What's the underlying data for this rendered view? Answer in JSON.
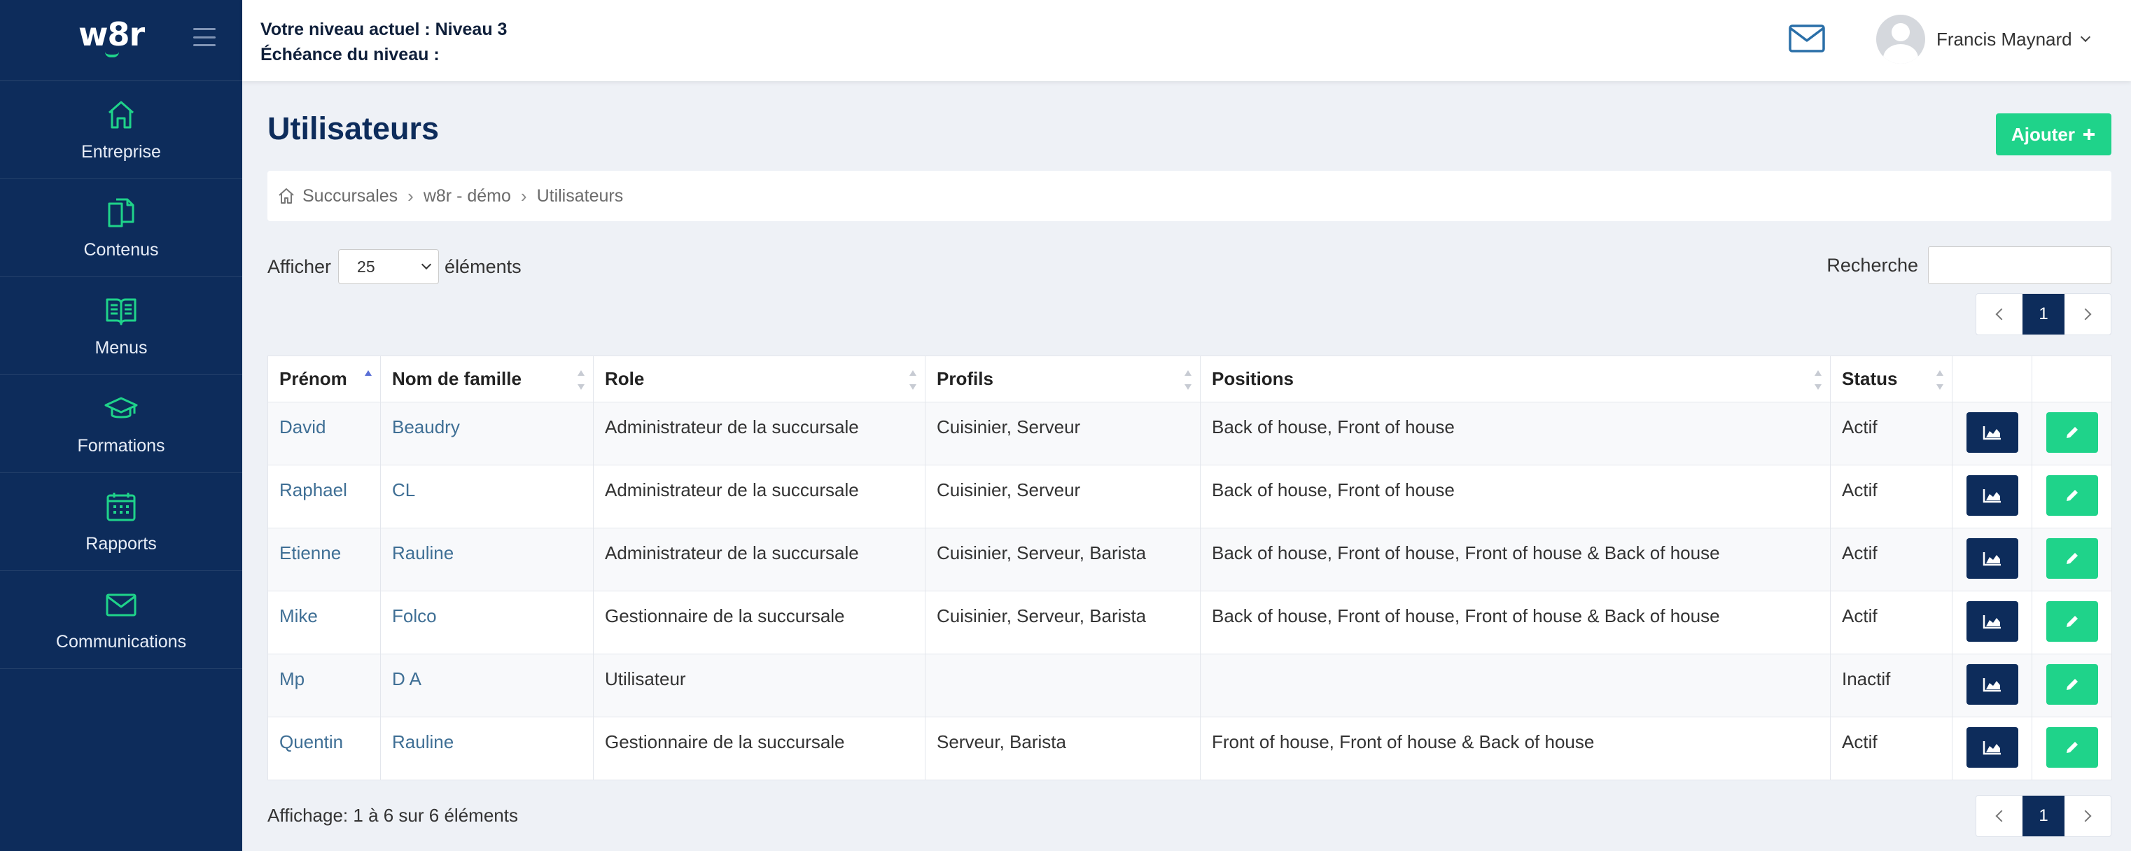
{
  "app": {
    "logo": "w8r"
  },
  "sidebar": {
    "items": [
      {
        "label": "Entreprise",
        "icon": "home-icon"
      },
      {
        "label": "Contenus",
        "icon": "documents-icon"
      },
      {
        "label": "Menus",
        "icon": "book-icon"
      },
      {
        "label": "Formations",
        "icon": "graduation-cap-icon"
      },
      {
        "label": "Rapports",
        "icon": "calendar-icon"
      },
      {
        "label": "Communications",
        "icon": "envelope-icon"
      }
    ]
  },
  "header": {
    "level_line": "Votre niveau actuel : Niveau 3",
    "deadline_line": "Échéance du niveau :",
    "user_name": "Francis Maynard"
  },
  "page": {
    "title": "Utilisateurs",
    "add_label": "Ajouter",
    "breadcrumb": [
      "Succursales",
      "w8r - démo",
      "Utilisateurs"
    ],
    "show_label": "Afficher",
    "page_size": "25",
    "elements_label": "éléments",
    "search_label": "Recherche",
    "current_page": "1",
    "footer_info": "Affichage: 1 à 6 sur 6 éléments"
  },
  "table": {
    "headers": [
      "Prénom",
      "Nom de famille",
      "Role",
      "Profils",
      "Positions",
      "Status"
    ],
    "rows": [
      {
        "first": "David",
        "last": "Beaudry",
        "role": "Administrateur de la succursale",
        "profils": "Cuisinier, Serveur",
        "positions": "Back of house, Front of house",
        "status": "Actif"
      },
      {
        "first": "Raphael",
        "last": "CL",
        "role": "Administrateur de la succursale",
        "profils": "Cuisinier, Serveur",
        "positions": "Back of house, Front of house",
        "status": "Actif"
      },
      {
        "first": "Etienne",
        "last": "Rauline",
        "role": "Administrateur de la succursale",
        "profils": "Cuisinier, Serveur, Barista",
        "positions": "Back of house, Front of house, Front of house & Back of house",
        "status": "Actif"
      },
      {
        "first": "Mike",
        "last": "Folco",
        "role": "Gestionnaire de la succursale",
        "profils": "Cuisinier, Serveur, Barista",
        "positions": "Back of house, Front of house, Front of house & Back of house",
        "status": "Actif"
      },
      {
        "first": "Mp",
        "last": "D A",
        "role": "Utilisateur",
        "profils": "",
        "positions": "",
        "status": "Inactif"
      },
      {
        "first": "Quentin",
        "last": "Rauline",
        "role": "Gestionnaire de la succursale",
        "profils": "Serveur, Barista",
        "positions": "Front of house, Front of house & Back of house",
        "status": "Actif"
      }
    ]
  },
  "colors": {
    "navy": "#0d2c5b",
    "green": "#1fd38a",
    "link": "#3f6f95"
  }
}
